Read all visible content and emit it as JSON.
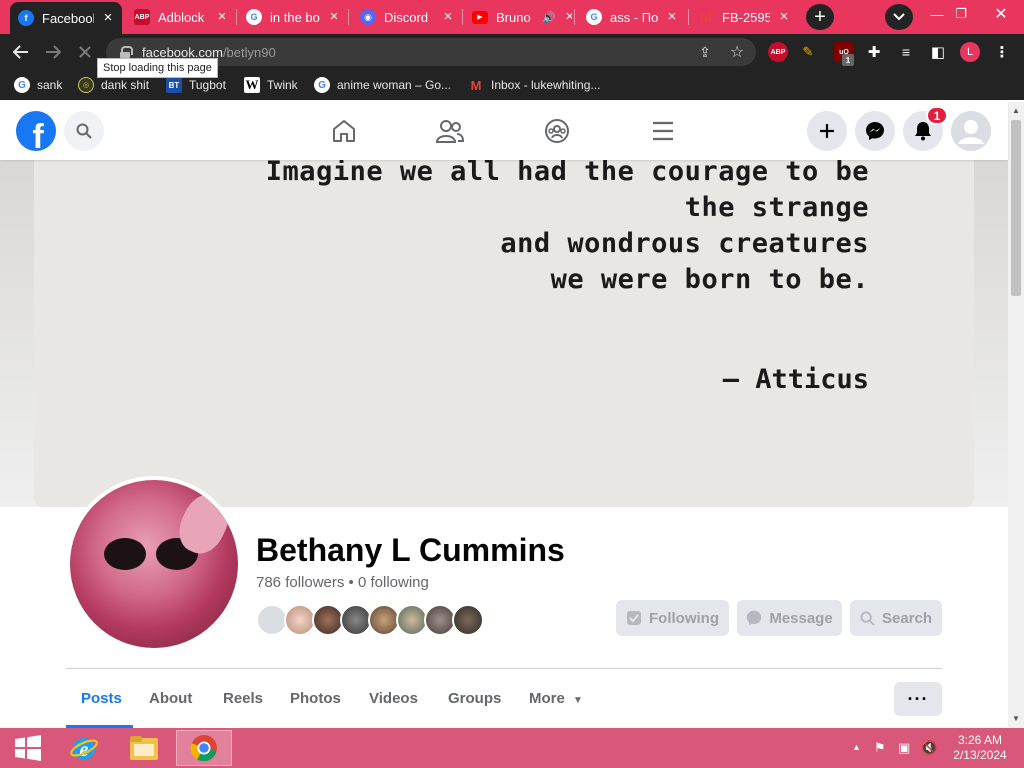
{
  "browser": {
    "tabs": [
      {
        "title": "Facebook",
        "favicon": "facebook-icon",
        "active": true
      },
      {
        "title": "Adblock",
        "favicon": "adblock-icon"
      },
      {
        "title": "in the bo",
        "favicon": "google-icon"
      },
      {
        "title": "Discord",
        "favicon": "discord-icon"
      },
      {
        "title": "Bruno",
        "favicon": "youtube-icon"
      },
      {
        "title": "ass - По",
        "favicon": "google-icon"
      },
      {
        "title": "FB-2595",
        "favicon": "gmail-icon"
      }
    ],
    "url_host": "facebook.com",
    "url_path": "/betlyn90",
    "tooltip": "Stop loading this page",
    "bookmarks": [
      {
        "label": "sank",
        "icon": "google-icon"
      },
      {
        "label": "dank shit",
        "icon": "bookmark-icon"
      },
      {
        "label": "Tugbot",
        "icon": "tugbot-icon"
      },
      {
        "label": "Twink",
        "icon": "wiki-icon"
      },
      {
        "label": "anime woman – Go...",
        "icon": "google-icon"
      },
      {
        "label": "Inbox - lukewhiting...",
        "icon": "gmail-icon"
      }
    ],
    "extensions": {
      "abp": "ABP",
      "ublock_badge": "1",
      "profile": "L"
    },
    "accent": "#e8365e"
  },
  "facebook": {
    "notification_count": "1",
    "brand_color": "#1877f2",
    "cover_quote_lines": [
      "Imagine we all had the courage to be",
      "the strange",
      "and wondrous creatures",
      "we were born to be."
    ],
    "cover_attribution": "– Atticus",
    "profile_name": "Bethany L Cummins",
    "stats": "786 followers • 0 following",
    "actions": {
      "following": "Following",
      "message": "Message",
      "search": "Search"
    },
    "profile_tabs": [
      "Posts",
      "About",
      "Reels",
      "Photos",
      "Videos",
      "Groups",
      "More"
    ],
    "more_menu": "···"
  },
  "taskbar": {
    "time": "3:26 AM",
    "date": "2/13/2024"
  }
}
